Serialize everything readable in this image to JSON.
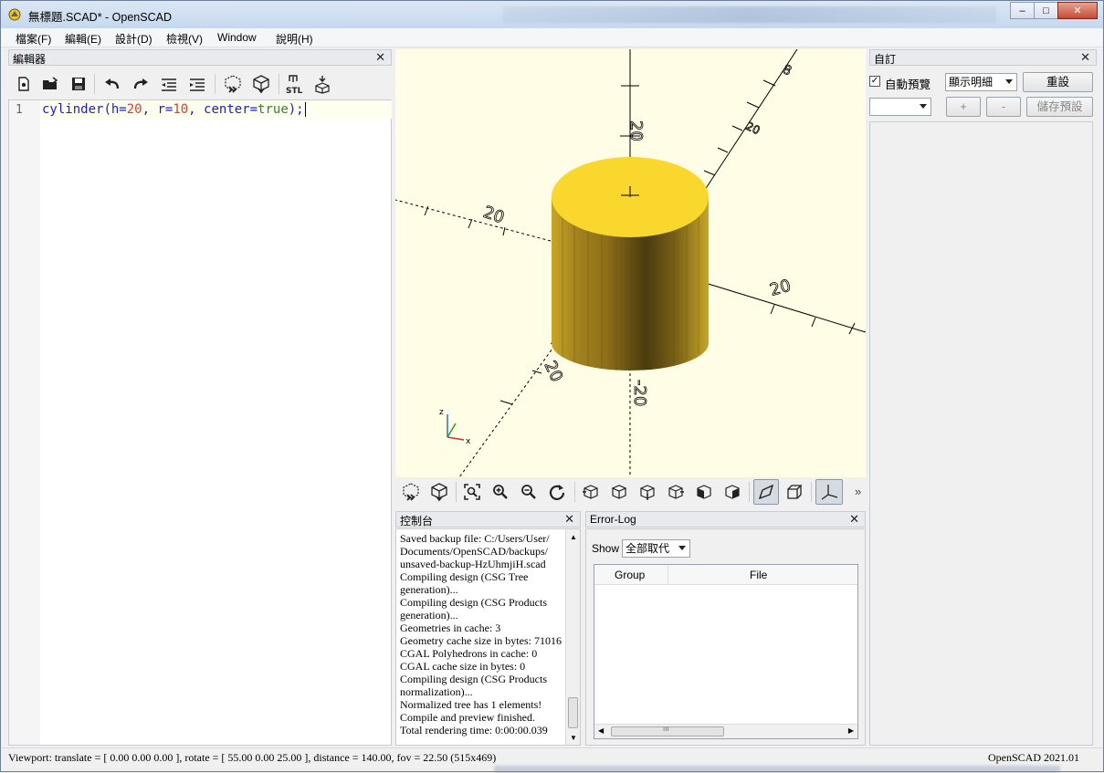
{
  "window": {
    "title": "無標題.SCAD* - OpenSCAD",
    "controls": {
      "minimize": "–",
      "maximize": "□",
      "close": "✕"
    }
  },
  "menu": [
    {
      "label": "檔案(F)"
    },
    {
      "label": "編輯(E)"
    },
    {
      "label": "設計(D)"
    },
    {
      "label": "檢視(V)"
    },
    {
      "label": "Window"
    },
    {
      "label": "說明(H)"
    }
  ],
  "editor": {
    "title": "編輯器",
    "toolbar": [
      "new-file-icon",
      "open-file-icon",
      "save-icon",
      "undo-icon",
      "redo-icon",
      "unindent-icon",
      "indent-icon",
      "preview-icon",
      "render-icon",
      "export-stl-icon",
      "send-to-3d-print-icon"
    ],
    "line_number": "1",
    "code": {
      "fn": "cylinder",
      "p1": "(h=",
      "h": "20",
      "p2": ", r=",
      "r": "10",
      "p3": ", center=",
      "center": "true",
      "p4": ");"
    }
  },
  "viewport": {
    "axis_labels": {
      "z_pos": "20",
      "y_pos": "20",
      "x_neg": "20",
      "x_pos": "20",
      "y_neg": "20",
      "z_neg": "-20",
      "y_tick": "8"
    },
    "gizmo": {
      "z": "z",
      "x": "x"
    },
    "cylinder_color": "#f9d72c"
  },
  "view_toolbar": [
    "preview-icon",
    "render-icon",
    "view-all-icon",
    "zoom-in-icon",
    "zoom-out-icon",
    "reset-view-icon",
    "view-right-icon",
    "view-top-icon",
    "view-bottom-icon",
    "view-left-icon",
    "view-front-icon",
    "view-back-icon",
    "perspective-icon",
    "orthogonal-icon",
    "show-axes-icon"
  ],
  "view_toolbar_more": "»",
  "console": {
    "title": "控制台",
    "lines": [
      "Saved backup file: C:/Users/User/",
      "Documents/OpenSCAD/backups/",
      "unsaved-backup-HzUhmjiH.scad",
      "Compiling design (CSG Tree",
      "generation)...",
      "Compiling design (CSG Products",
      "generation)...",
      "Geometries in cache: 3",
      "Geometry cache size in bytes: 71016",
      "CGAL Polyhedrons in cache: 0",
      "CGAL cache size in bytes: 0",
      "Compiling design (CSG Products",
      "normalization)...",
      "Normalized tree has 1 elements!",
      "Compile and preview finished.",
      "Total rendering time: 0:00:00.039"
    ]
  },
  "error_log": {
    "title": "Error-Log",
    "show_label": "Show",
    "show_value": "全部取代",
    "columns": [
      "Group",
      "File"
    ]
  },
  "customizer": {
    "title": "自訂",
    "auto_preview_label": "自動預覽",
    "auto_preview_checked": true,
    "detail_value": "顯示明細",
    "reset_label": "重設",
    "preset_value": "",
    "add_label": "+",
    "remove_label": "-",
    "save_preset_label": "儲存預設"
  },
  "status": {
    "viewport": "Viewport: translate = [ 0.00 0.00 0.00 ], rotate = [ 55.00 0.00 25.00 ], distance = 140.00, fov = 22.50 (515x469)",
    "version": "OpenSCAD 2021.01"
  }
}
